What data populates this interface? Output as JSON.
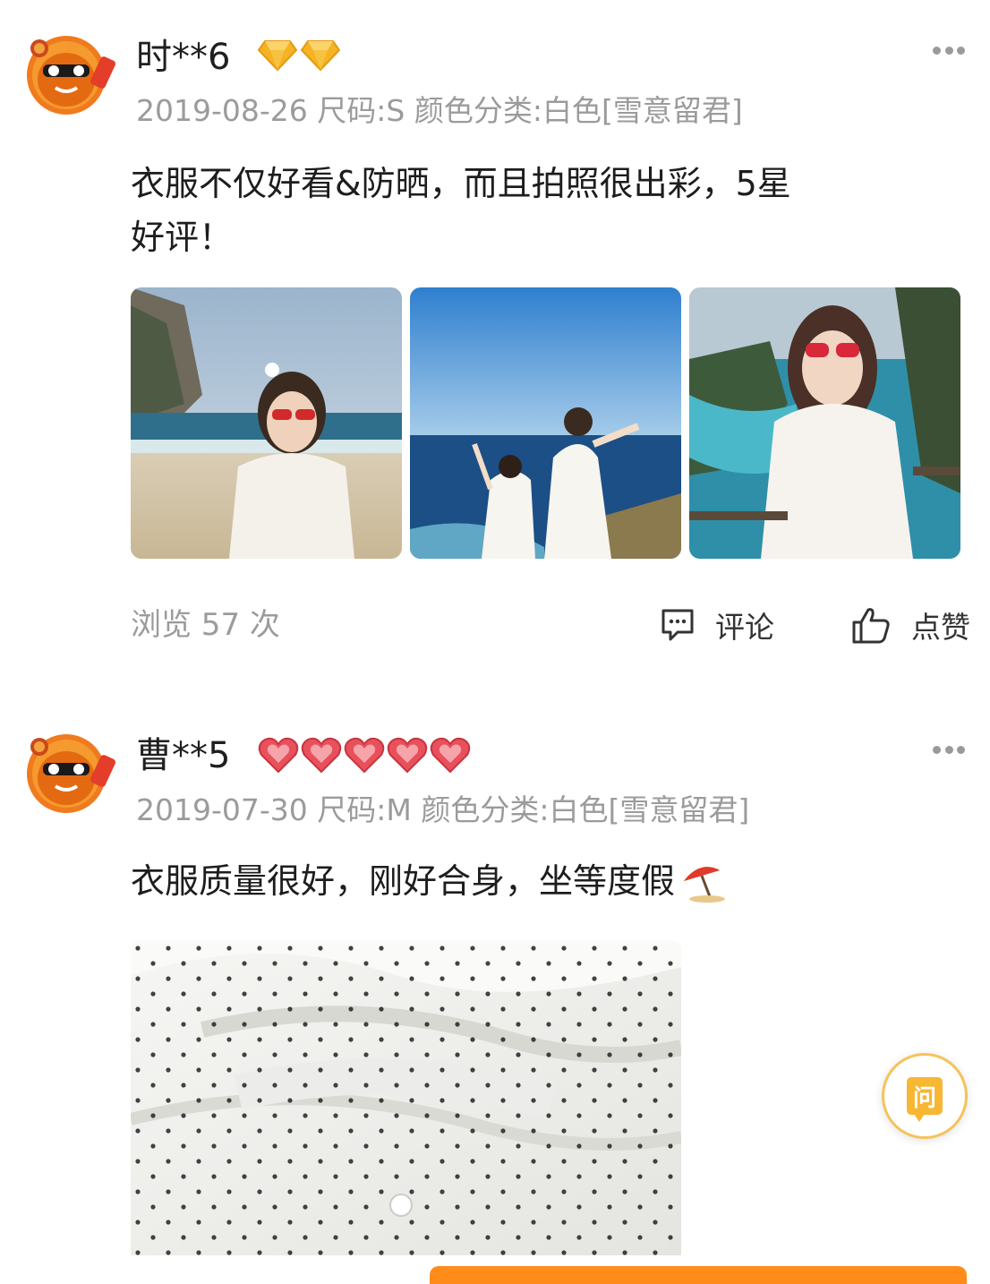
{
  "reviews": [
    {
      "username": "时**6",
      "badge_icon": "diamond-icon",
      "badge_count": 2,
      "date": "2019-08-26",
      "size": "尺码:S",
      "color": "颜色分类:白色[雪意留君]",
      "text_line1": "衣服不仅好看&防晒，而且拍照很出彩，5星",
      "text_line2": "好评！",
      "photos": [
        "beach-photo",
        "ocean-cliff-photo",
        "cliff-selfie-photo"
      ],
      "views": "浏览 57 次",
      "comment_label": "评论",
      "like_label": "点赞"
    },
    {
      "username": "曹**5",
      "badge_icon": "heart-icon",
      "badge_count": 5,
      "date": "2019-07-30",
      "size": "尺码:M",
      "color": "颜色分类:白色[雪意留君]",
      "text_line1": "衣服质量很好，刚好合身，坐等度假",
      "emoji": "umbrella-on-ground-icon",
      "photos": [
        "dress-closeup-photo"
      ]
    }
  ],
  "ask_button": {
    "label": "问",
    "color": "#f7b733"
  },
  "colors": {
    "meta_text": "#9b9b9b",
    "diamond": "#f5b324",
    "heart": "#e8505b",
    "accent": "#ff8c1a"
  }
}
